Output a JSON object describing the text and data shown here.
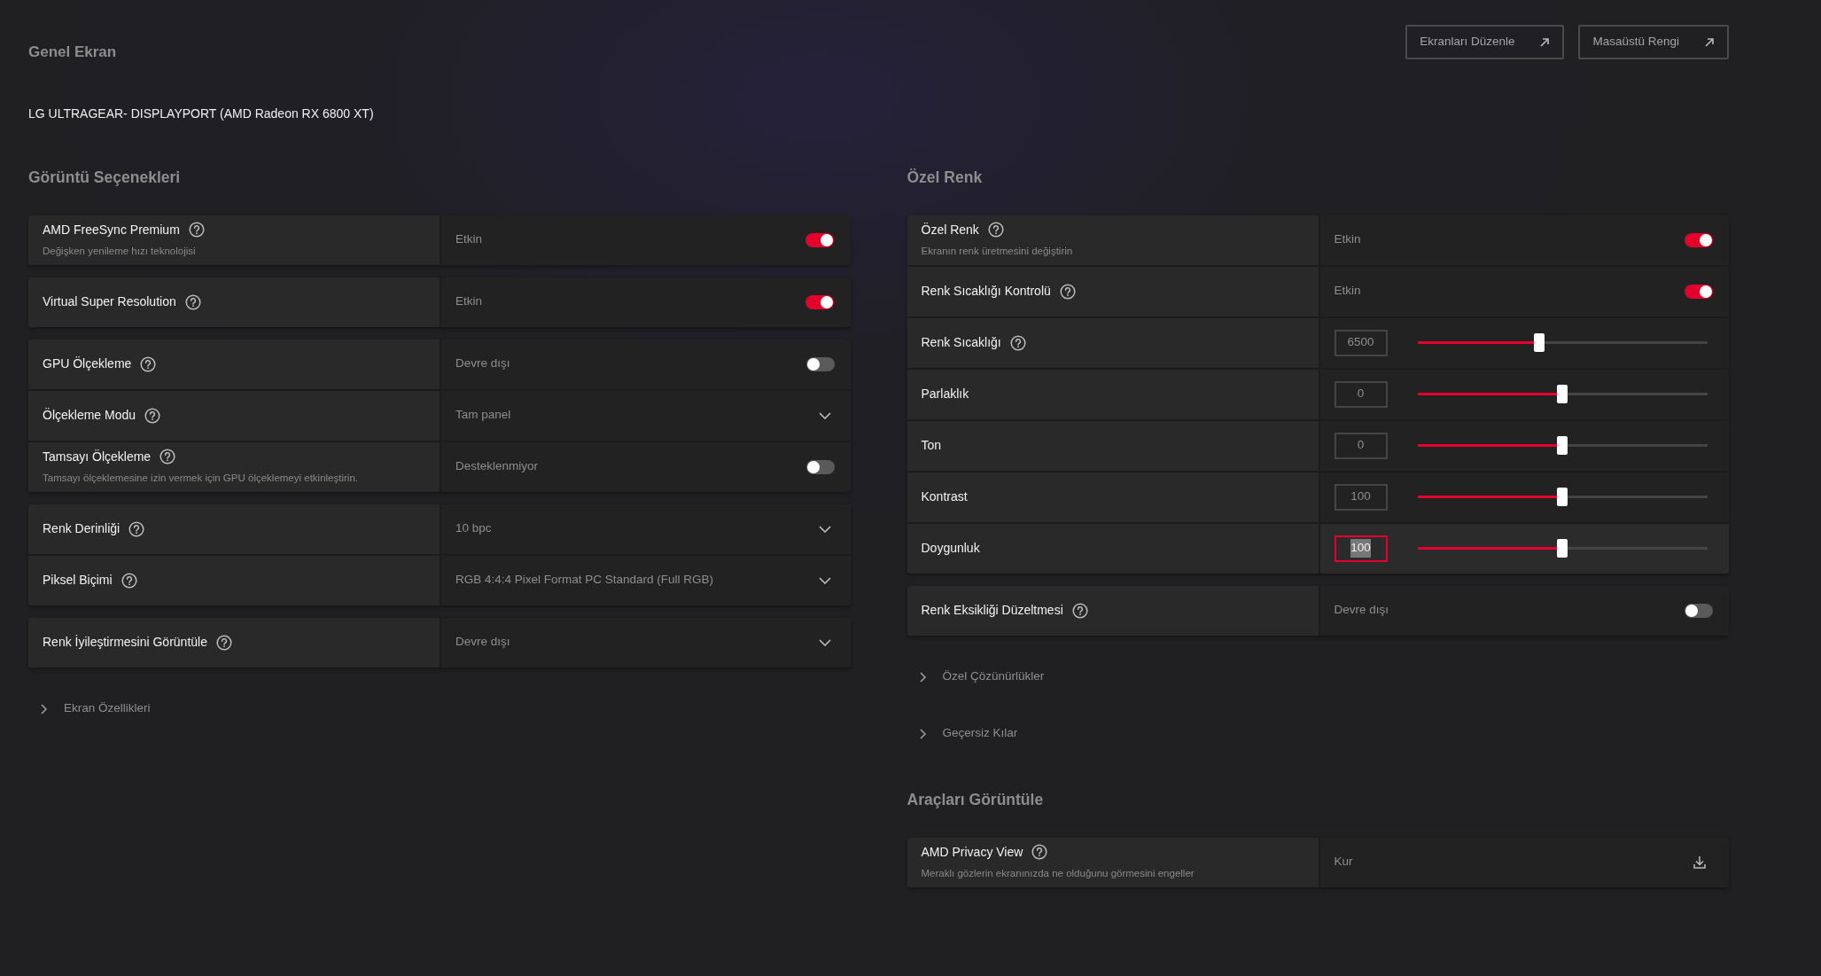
{
  "header": {
    "title": "Genel Ekran",
    "buttons": [
      {
        "label": "Ekranları Düzenle"
      },
      {
        "label": "Masaüstü Rengi"
      }
    ]
  },
  "display_name": "LG ULTRAGEAR- DISPLAYPORT (AMD Radeon RX 6800 XT)",
  "columns": [
    [
      {
        "kind": "section",
        "title": "Görüntü Seçenekleri",
        "groups": [
          {
            "rows": [
              {
                "label": "AMD FreeSync Premium",
                "help": true,
                "description": "Değişken yenileme hızı teknolojisi",
                "kind": "toggle",
                "value": "Etkin",
                "on": true
              }
            ]
          },
          {
            "rows": [
              {
                "label": "Virtual Super Resolution",
                "help": true,
                "kind": "toggle",
                "value": "Etkin",
                "on": true
              }
            ]
          },
          {
            "rows": [
              {
                "label": "GPU Ölçekleme",
                "help": true,
                "kind": "toggle",
                "value": "Devre dışı",
                "on": false
              },
              {
                "label": "Ölçekleme Modu",
                "help": true,
                "kind": "dropdown",
                "value": "Tam panel"
              },
              {
                "label": "Tamsayı Ölçekleme",
                "help": true,
                "description": "Tamsayı ölçeklemesine izin vermek için GPU ölçeklemeyi etkinleştirin.",
                "kind": "toggle",
                "value": "Desteklenmiyor",
                "on": false
              }
            ]
          },
          {
            "rows": [
              {
                "label": "Renk Derinliği",
                "help": true,
                "kind": "dropdown",
                "value": "10 bpc"
              },
              {
                "label": "Piksel Biçimi",
                "help": true,
                "kind": "dropdown",
                "value": "RGB 4:4:4 Pixel Format PC Standard (Full RGB)"
              }
            ]
          },
          {
            "rows": [
              {
                "label": "Renk İyileştirmesini Görüntüle",
                "help": true,
                "kind": "dropdown",
                "value": "Devre dışı"
              }
            ]
          }
        ]
      },
      {
        "kind": "expander",
        "label": "Ekran Özellikleri",
        "expanded": false
      }
    ],
    [
      {
        "kind": "section",
        "title": "Özel Renk",
        "groups": [
          {
            "rows": [
              {
                "label": "Özel Renk",
                "help": true,
                "description": "Ekranın renk üretmesini değiştirin",
                "kind": "toggle",
                "value": "Etkin",
                "on": true
              },
              {
                "label": "Renk Sıcaklığı Kontrolü",
                "help": true,
                "kind": "toggle",
                "value": "Etkin",
                "on": true
              },
              {
                "label": "Renk Sıcaklığı",
                "help": true,
                "kind": "slider",
                "value": "6500",
                "level": 0.42,
                "focused": false
              },
              {
                "label": "Parlaklık",
                "help": false,
                "kind": "slider",
                "value": "0",
                "level": 0.5,
                "focused": false
              },
              {
                "label": "Ton",
                "help": false,
                "kind": "slider",
                "value": "0",
                "level": 0.5,
                "focused": false
              },
              {
                "label": "Kontrast",
                "help": false,
                "kind": "slider",
                "value": "100",
                "level": 0.5,
                "focused": false
              },
              {
                "label": "Doygunluk",
                "help": false,
                "kind": "slider",
                "value": "100",
                "level": 0.5,
                "focused": true
              }
            ]
          },
          {
            "rows": [
              {
                "label": "Renk Eksikliği Düzeltmesi",
                "help": true,
                "kind": "toggle",
                "value": "Devre dışı",
                "on": false
              }
            ]
          }
        ]
      },
      {
        "kind": "expander",
        "label": "Özel Çözünürlükler",
        "expanded": false
      },
      {
        "kind": "expander",
        "label": "Geçersiz Kılar",
        "expanded": false
      },
      {
        "kind": "section",
        "title": "Araçları Görüntüle",
        "groups": [
          {
            "rows": [
              {
                "label": "AMD Privacy View",
                "help": true,
                "description": "Meraklı gözlerin ekranınızda ne olduğunu görmesini engeller",
                "kind": "download",
                "value": "Kur"
              }
            ]
          }
        ]
      }
    ]
  ]
}
